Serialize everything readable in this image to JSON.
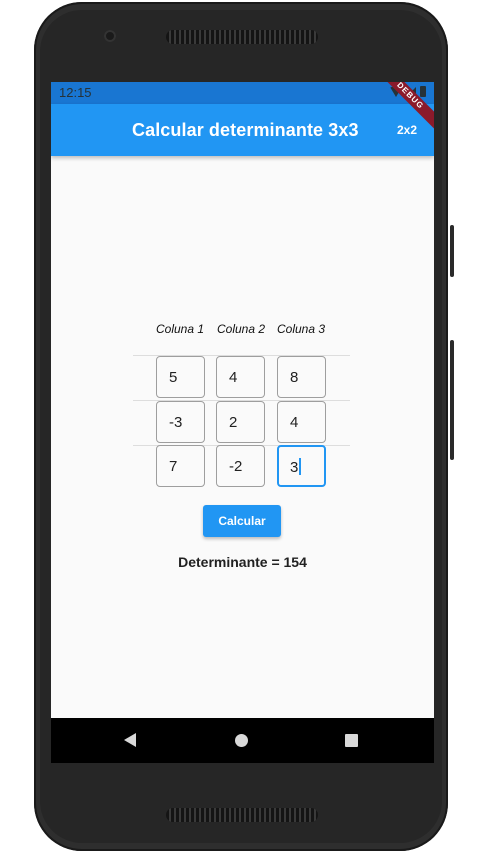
{
  "status_bar": {
    "time": "12:15",
    "icons": [
      "wifi-icon",
      "signal-icon",
      "battery-icon"
    ]
  },
  "app_bar": {
    "title": "Calcular determinante 3x3",
    "action_label": "2x2",
    "debug_banner": "DEBUG"
  },
  "matrix": {
    "column_headers": [
      "Coluna 1",
      "Coluna 2",
      "Coluna 3"
    ],
    "rows": [
      [
        "5",
        "4",
        "8"
      ],
      [
        "-3",
        "2",
        "4"
      ],
      [
        "7",
        "-2",
        "3"
      ]
    ],
    "focused_cell": "row 3, column 3"
  },
  "calculate_button": {
    "label": "Calcular"
  },
  "result": {
    "text": "Determinante = 154"
  },
  "nav_bar": {
    "icons": [
      "back-icon",
      "home-icon",
      "recents-icon"
    ]
  },
  "colors": {
    "primary": "#2196f3",
    "status_bar": "#1976d2",
    "debug_ribbon": "#8b1a2b"
  }
}
